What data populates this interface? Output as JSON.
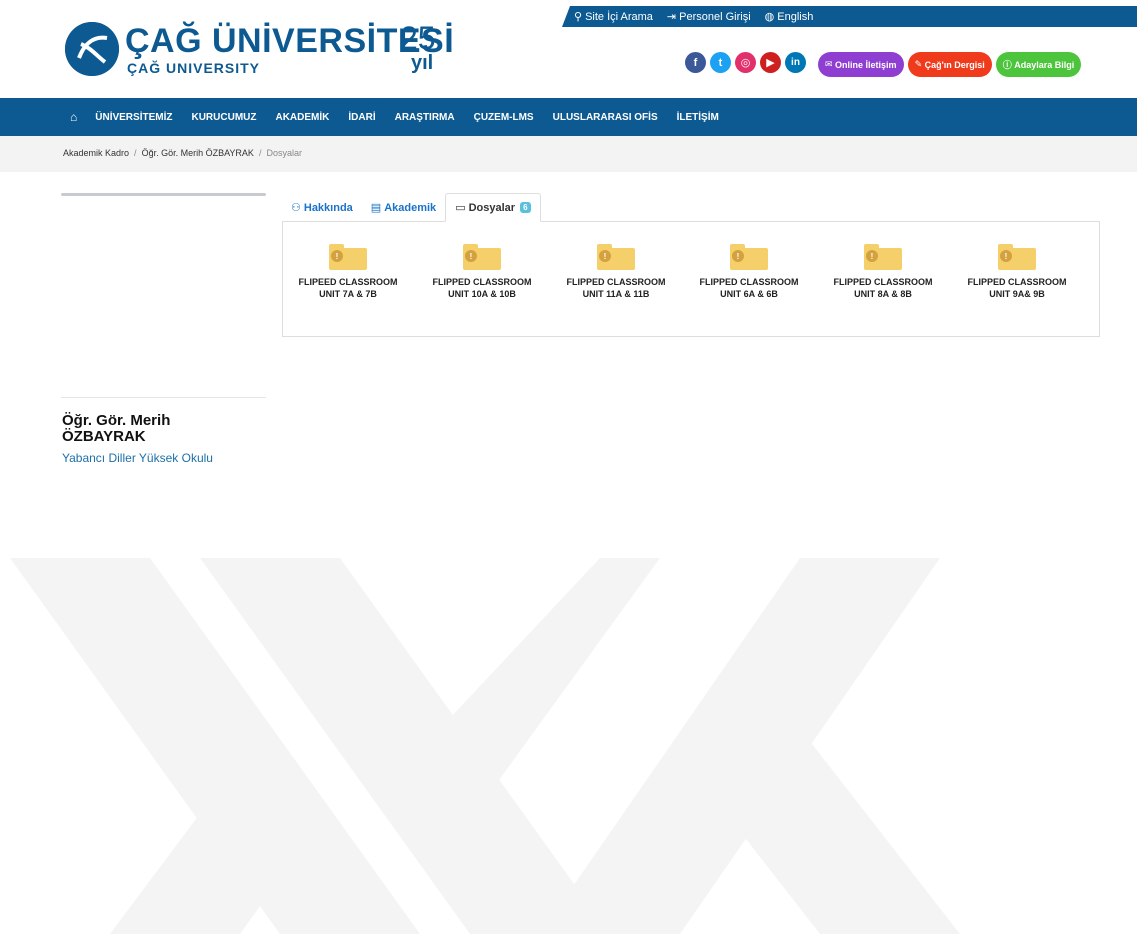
{
  "topbar": {
    "search": "Site İçi Arama",
    "staff_login": "Personel Girişi",
    "language": "English"
  },
  "logo": {
    "title": "ÇAĞ ÜNİVERSİTESİ",
    "subtitle": "ÇAĞ UNIVERSITY",
    "anniversary_number": "25.",
    "anniversary_word": "yıl"
  },
  "social": [
    {
      "name": "facebook-icon",
      "glyph": "f",
      "color": "#3b5998"
    },
    {
      "name": "twitter-icon",
      "glyph": "t",
      "color": "#1da1f2"
    },
    {
      "name": "instagram-icon",
      "glyph": "◎",
      "color": "#e1306c"
    },
    {
      "name": "youtube-icon",
      "glyph": "▶",
      "color": "#cd201f"
    },
    {
      "name": "linkedin-icon",
      "glyph": "in",
      "color": "#0077b5"
    }
  ],
  "pills": {
    "online": "Online İletişim",
    "magazine": "Çağ'ın Dergisi",
    "candidates": "Adaylara Bilgi"
  },
  "nav": {
    "items": [
      "ÜNİVERSİTEMİZ",
      "KURUCUMUZ",
      "AKADEMİK",
      "İDARİ",
      "ARAŞTIRMA",
      "ÇUZEM-LMS",
      "ULUSLARARASI OFİS",
      "İLETİŞİM"
    ]
  },
  "breadcrumb": {
    "level1": "Akademik Kadro",
    "level2": "Öğr. Gör. Merih ÖZBAYRAK",
    "current": "Dosyalar",
    "separator": "/"
  },
  "person": {
    "name": "Öğr. Gör. Merih ÖZBAYRAK",
    "department": "Yabancı Diller Yüksek Okulu"
  },
  "tabs": {
    "about": "Hakkında",
    "academic": "Akademik",
    "files": "Dosyalar",
    "files_count": "6"
  },
  "files": [
    {
      "line1": "FLIPEED CLASSROOM",
      "line2": "UNIT 7A & 7B"
    },
    {
      "line1": "FLIPPED CLASSROOM",
      "line2": "UNIT 10A & 10B"
    },
    {
      "line1": "FLIPPED CLASSROOM",
      "line2": "UNIT 11A & 11B"
    },
    {
      "line1": "FLIPPED CLASSROOM",
      "line2": "UNIT 6A & 6B"
    },
    {
      "line1": "FLIPPED CLASSROOM",
      "line2": "UNIT 8A & 8B"
    },
    {
      "line1": "FLIPPED CLASSROOM",
      "line2": "UNIT 9A& 9B"
    }
  ],
  "colors": {
    "brand": "#0d5a92",
    "online_pill": "#8e3fd1",
    "magazine_pill": "#f03a1c",
    "candidates_pill": "#4cc43c"
  }
}
